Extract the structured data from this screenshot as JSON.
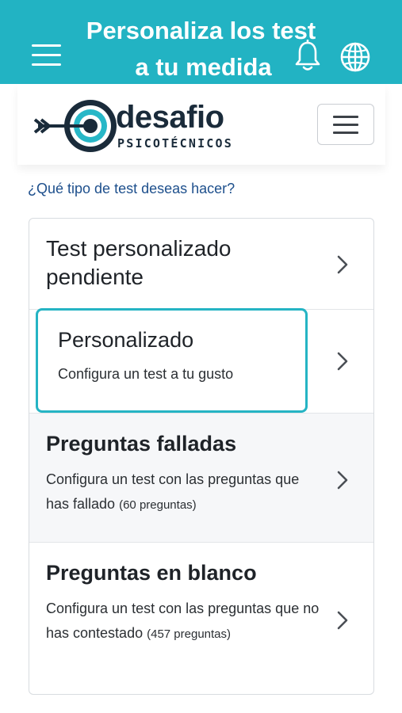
{
  "banner": {
    "title_line1": "Personaliza los test",
    "title_line2": "a tu medida"
  },
  "header": {
    "logo_name": "desafio",
    "logo_sub": "PSICOTÉCNICOS"
  },
  "question": "¿Qué tipo de test deseas hacer?",
  "options": [
    {
      "title": "Test personalizado pendiente",
      "description": "",
      "count": ""
    },
    {
      "title": "Personalizado",
      "description": "Configura un test a tu gusto",
      "count": ""
    },
    {
      "title": "Preguntas falladas",
      "description": "Configura un test con las preguntas que has fallado",
      "count": "(60 preguntas)"
    },
    {
      "title": "Preguntas en blanco",
      "description": "Configura un test con las preguntas que no has contestado",
      "count": "(457 preguntas)"
    }
  ],
  "colors": {
    "accent": "#22b3c3",
    "link": "#1d4f8c",
    "logo_dark": "#1a2b3a"
  },
  "icons": [
    "menu-icon",
    "bell-icon",
    "globe-icon",
    "target-arrow-logo-icon",
    "hamburger-icon",
    "chevron-right-icon"
  ]
}
